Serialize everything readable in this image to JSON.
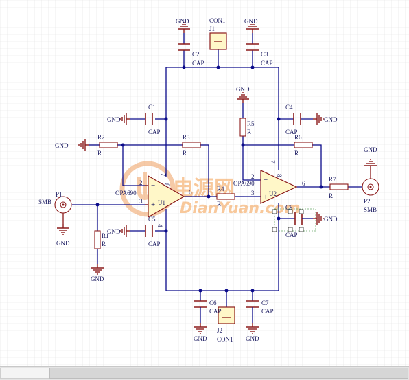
{
  "schematic": {
    "gnd_label": "GND",
    "smb_label": "SMB",
    "cap_label": "CAP",
    "res_label": "R",
    "opamp_model": "OPA690",
    "connector_model": "CON1",
    "watermark": {
      "brand_cn": "电源网",
      "url": "DianYuan.com"
    },
    "designators": {
      "P1": "P1",
      "P2": "P2",
      "J1": "J1",
      "J2": "J2",
      "C1": "C1",
      "C2": "C2",
      "C3": "C3",
      "C4": "C4",
      "C5": "C5",
      "C6": "C6",
      "C7": "C7",
      "C8": "C8",
      "R1": "R1",
      "R2": "R2",
      "R3": "R3",
      "R4": "R4",
      "R5": "R5",
      "R6": "R6",
      "R7": "R7",
      "U1": "U1",
      "U2": "U2"
    },
    "pins": {
      "u1_plus": "3",
      "u1_minus": "2",
      "u1_out": "6",
      "u1_vplus": "7",
      "u1_vminus": "4",
      "u1_dis": "8",
      "u2_plus": "3",
      "u2_minus": "2",
      "u2_out": "6",
      "u2_vplus": "7",
      "u2_vminus": "4",
      "u2_dis": "8"
    },
    "colors": {
      "wire": "#0a0a8a",
      "component": "#8b1a1a",
      "opamp_fill": "#fff7c8",
      "text": "#1a1a60",
      "grid": "#e2e2e2"
    }
  }
}
